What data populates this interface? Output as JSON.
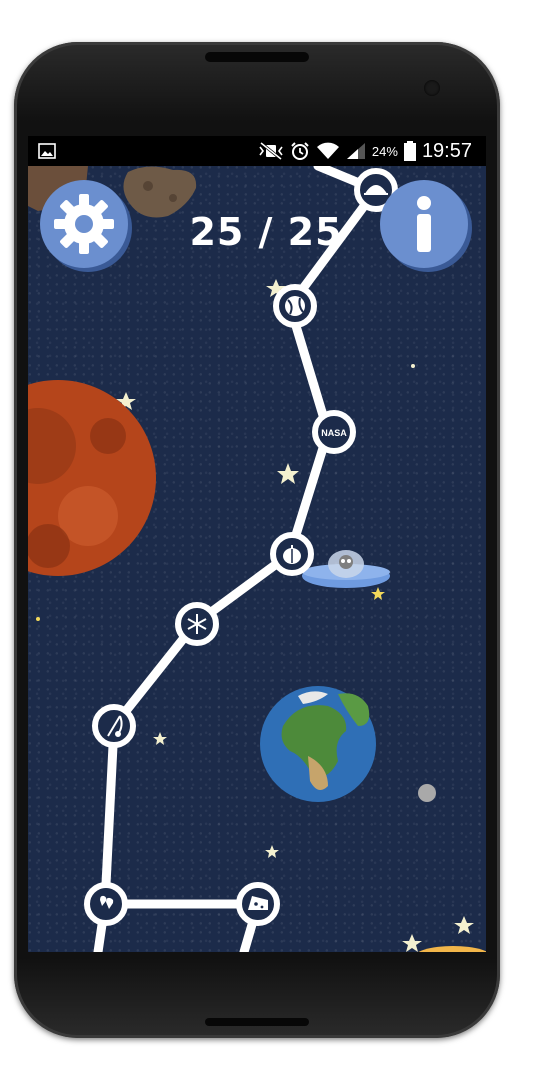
{
  "status_bar": {
    "battery_percent": "24%",
    "time": "19:57",
    "icons": [
      "image-notification-icon",
      "mute-vibrate-icon",
      "alarm-icon",
      "wifi-icon",
      "signal-icon",
      "battery-icon"
    ]
  },
  "header": {
    "score": "25 / 25",
    "settings_icon": "gear-icon",
    "info_icon": "info-icon"
  },
  "level_nodes": [
    {
      "name": "level-node-turtle",
      "icon": "turtle-icon"
    },
    {
      "name": "level-node-globe",
      "icon": "globe-icon"
    },
    {
      "name": "level-node-nasa",
      "icon": "nasa-logo",
      "label": "NASA"
    },
    {
      "name": "level-node-pumpkin",
      "icon": "pumpkin-icon"
    },
    {
      "name": "level-node-snowflake",
      "icon": "snowflake-icon"
    },
    {
      "name": "level-node-fishing",
      "icon": "fishing-rod-icon"
    },
    {
      "name": "level-node-hearts",
      "icon": "hearts-icon"
    },
    {
      "name": "level-node-cheese",
      "icon": "cheese-icon"
    }
  ],
  "colors": {
    "background": "#1c2b4a",
    "button": "#6b8fcf",
    "button_shadow": "#3a5a96",
    "path": "#ffffff",
    "mars": "#b5451b",
    "earth_ocean": "#2f6fb6",
    "ufo": "#6f9be0"
  }
}
